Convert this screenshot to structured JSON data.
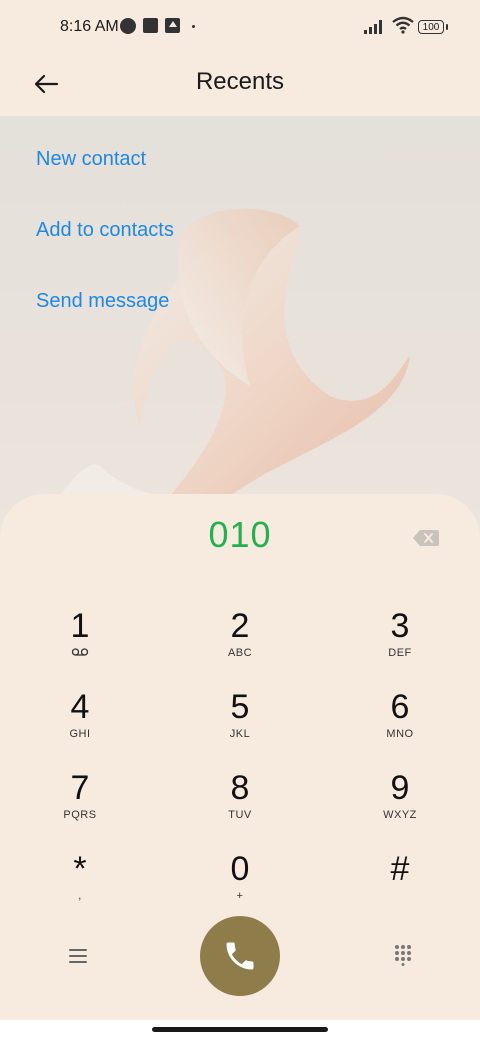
{
  "status_bar": {
    "time": "8:16 AM",
    "battery": "100",
    "icons": [
      "vpn-icon",
      "notification-square-icon",
      "upload-icon",
      "dot-icon",
      "signal-icon",
      "wifi-icon",
      "battery-icon"
    ]
  },
  "header": {
    "title": "Recents",
    "back_icon": "arrow-left-icon"
  },
  "actions": {
    "new_contact": "New contact",
    "add_to_contacts": "Add to contacts",
    "send_message": "Send message"
  },
  "dialer": {
    "number": "010",
    "backspace_icon": "backspace-icon",
    "keys": [
      {
        "digit": "1",
        "letters": ""
      },
      {
        "digit": "2",
        "letters": "ABC"
      },
      {
        "digit": "3",
        "letters": "DEF"
      },
      {
        "digit": "4",
        "letters": "GHI"
      },
      {
        "digit": "5",
        "letters": "JKL"
      },
      {
        "digit": "6",
        "letters": "MNO"
      },
      {
        "digit": "7",
        "letters": "PQRS"
      },
      {
        "digit": "8",
        "letters": "TUV"
      },
      {
        "digit": "9",
        "letters": "WXYZ"
      },
      {
        "digit": "*",
        "letters": ","
      },
      {
        "digit": "0",
        "letters": "+"
      },
      {
        "digit": "#",
        "letters": ""
      }
    ],
    "voicemail_icon": "voicemail-icon",
    "menu_icon": "menu-icon",
    "call_icon": "phone-icon",
    "keypad_icon": "keypad-icon"
  },
  "colors": {
    "accent_link": "#1e88e5",
    "number": "#1fb34a",
    "call_button": "#8f7c4b",
    "background": "#f7ebe0"
  }
}
